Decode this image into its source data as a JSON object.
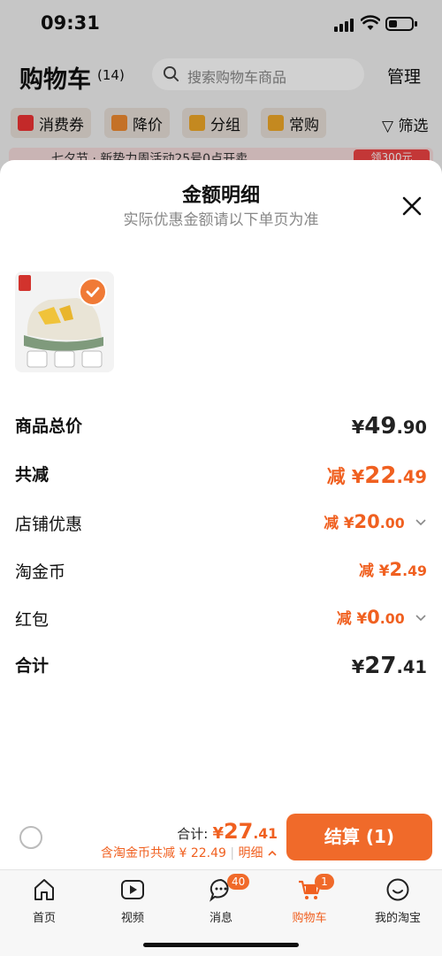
{
  "status_bar": {
    "time": "09:31"
  },
  "cart": {
    "title": "购物车",
    "count": "(14)",
    "search_placeholder": "搜索购物车商品",
    "manage_label": "管理",
    "chips": [
      "消费券",
      "降价",
      "分组",
      "常购"
    ],
    "filter_label": "筛选",
    "promo_text": "七夕节 · 新势力周活动25号0点开卖",
    "promo_button": "领300元"
  },
  "sheet": {
    "title": "金额明细",
    "subtitle": "实际优惠金额请以下单页为准",
    "rows": [
      {
        "label": "商品总价",
        "prefix": "¥",
        "int": "49",
        "dec": ".90"
      },
      {
        "label": "共减",
        "prefix": "减 ¥",
        "int": "22",
        "dec": ".49"
      },
      {
        "label": "店铺优惠",
        "prefix": "减 ¥",
        "int": "20",
        "dec": ".00"
      },
      {
        "label": "淘金币",
        "prefix": "减 ¥",
        "int": "2",
        "dec": ".49"
      },
      {
        "label": "红包",
        "prefix": "减 ¥",
        "int": "0",
        "dec": ".00"
      },
      {
        "label": "合计",
        "prefix": "¥",
        "int": "27",
        "dec": ".41"
      }
    ]
  },
  "checkout": {
    "total_label": "合计:",
    "total_prefix": "¥",
    "total_int": "27",
    "total_dec": ".41",
    "discount_text": "含淘金币共减 ¥ 22.49",
    "details_label": "明细",
    "pay_button": "结算 (1)"
  },
  "tabs": [
    {
      "label": "首页",
      "icon": "home-icon"
    },
    {
      "label": "视频",
      "icon": "video-icon"
    },
    {
      "label": "消息",
      "icon": "message-icon",
      "badge": "40"
    },
    {
      "label": "购物车",
      "icon": "cart-icon",
      "badge": "1"
    },
    {
      "label": "我的淘宝",
      "icon": "profile-icon"
    }
  ],
  "colors": {
    "accent": "#f06a2a",
    "price_orange": "#f06020"
  }
}
